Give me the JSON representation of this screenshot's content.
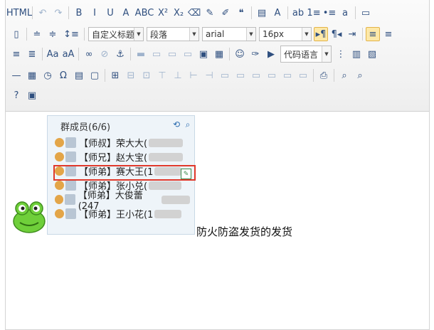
{
  "toolbar": {
    "row1": [
      {
        "name": "source-code-button",
        "text": "HTML"
      },
      {
        "name": "undo-button",
        "text": "↶"
      },
      {
        "name": "redo-button",
        "text": "↷"
      },
      {
        "name": "bold-button",
        "text": "B"
      },
      {
        "name": "italic-button",
        "text": "I"
      },
      {
        "name": "underline-button",
        "text": "U"
      },
      {
        "name": "font-border-button",
        "text": "A"
      },
      {
        "name": "strikethrough-button",
        "text": "ABC"
      },
      {
        "name": "superscript-button",
        "text": "X²"
      },
      {
        "name": "subscript-button",
        "text": "X₂"
      },
      {
        "name": "eraser-icon",
        "text": "⌫"
      },
      {
        "name": "format-painter-icon",
        "text": "✎"
      },
      {
        "name": "auto-format-icon",
        "text": "✐"
      },
      {
        "name": "blockquote-button",
        "text": "❝"
      },
      {
        "name": "paste-plain-icon",
        "text": "▤"
      },
      {
        "name": "font-color-button",
        "text": "A"
      },
      {
        "name": "back-color-button",
        "text": "ab"
      },
      {
        "name": "ordered-list-button",
        "text": "1≡"
      },
      {
        "name": "unordered-list-button",
        "text": "•≡"
      },
      {
        "name": "select-all-button",
        "text": "a"
      },
      {
        "name": "clear-doc-button",
        "text": "▭"
      }
    ],
    "selects": {
      "custom_title": "自定义标题",
      "paragraph": "段落",
      "font_family": "arial",
      "font_size": "16px",
      "code_language": "代码语言"
    },
    "row2_btns": [
      {
        "name": "clear-format-icon",
        "text": "▯"
      },
      {
        "name": "row-spacing-top-button",
        "text": "≐"
      },
      {
        "name": "row-spacing-bottom-button",
        "text": "≑"
      },
      {
        "name": "line-height-button",
        "text": "↕≡"
      }
    ],
    "row2_after": [
      {
        "name": "ltr-button",
        "text": "▸¶"
      },
      {
        "name": "rtl-button",
        "text": "¶◂"
      },
      {
        "name": "indent-button",
        "text": "⇥"
      },
      {
        "name": "align-left-button",
        "text": "≡"
      },
      {
        "name": "align-center-button",
        "text": "≡"
      }
    ],
    "row3": [
      {
        "name": "align-right-button",
        "text": "≡"
      },
      {
        "name": "justify-button",
        "text": "≣"
      },
      {
        "name": "to-uppercase-button",
        "text": "Aa"
      },
      {
        "name": "to-lowercase-button",
        "text": "aA"
      },
      {
        "name": "link-icon",
        "text": "∞"
      },
      {
        "name": "unlink-icon",
        "text": "⊘"
      },
      {
        "name": "anchor-icon",
        "text": "⚓"
      },
      {
        "name": "image-none-icon",
        "text": "▬"
      },
      {
        "name": "image-left-icon",
        "text": "▭"
      },
      {
        "name": "image-right-icon",
        "text": "▭"
      },
      {
        "name": "image-center-icon",
        "text": "▭"
      },
      {
        "name": "simple-upload-icon",
        "text": "▣"
      },
      {
        "name": "insert-image-icon",
        "text": "▦"
      },
      {
        "name": "emotion-icon",
        "text": "☺"
      },
      {
        "name": "scrawl-icon",
        "text": "✑"
      },
      {
        "name": "insert-video-icon",
        "text": "▶"
      }
    ],
    "row3_after": [
      {
        "name": "page-break-icon",
        "text": "⋮"
      },
      {
        "name": "template-icon",
        "text": "▥"
      },
      {
        "name": "background-icon",
        "text": "▧"
      }
    ],
    "row4": [
      {
        "name": "horizontal-rule-icon",
        "text": "—"
      },
      {
        "name": "date-icon",
        "text": "▦"
      },
      {
        "name": "time-icon",
        "text": "◷"
      },
      {
        "name": "special-char-icon",
        "text": "Ω"
      },
      {
        "name": "wordimage-icon",
        "text": "▤"
      },
      {
        "name": "snapscreen-icon",
        "text": "▢"
      },
      {
        "name": "insert-table-icon",
        "text": "⊞"
      },
      {
        "name": "delete-table-icon",
        "text": "⊟"
      },
      {
        "name": "insert-paragraph-before-table-icon",
        "text": "⊡"
      },
      {
        "name": "insert-row-icon",
        "text": "⊤"
      },
      {
        "name": "delete-row-icon",
        "text": "⊥"
      },
      {
        "name": "insert-col-icon",
        "text": "⊢"
      },
      {
        "name": "delete-col-icon",
        "text": "⊣"
      },
      {
        "name": "merge-cells-icon",
        "text": "▭"
      },
      {
        "name": "merge-right-icon",
        "text": "▭"
      },
      {
        "name": "merge-down-icon",
        "text": "▭"
      },
      {
        "name": "split-cells-icon",
        "text": "▭"
      },
      {
        "name": "split-rows-icon",
        "text": "▭"
      },
      {
        "name": "split-cols-icon",
        "text": "▭"
      },
      {
        "name": "print-icon",
        "text": "⎙"
      },
      {
        "name": "preview-icon",
        "text": "⌕"
      },
      {
        "name": "search-replace-icon",
        "text": "⌕"
      }
    ],
    "row5": [
      {
        "name": "help-icon",
        "text": "?"
      },
      {
        "name": "drafts-icon",
        "text": "▣"
      }
    ]
  },
  "qq": {
    "title": "群成员(6/6)",
    "members": [
      {
        "label": "【师叔】荣大大("
      },
      {
        "label": "【师兄】赵大宝("
      },
      {
        "label": "【师弟】赛大王(1"
      },
      {
        "label": "【师弟】张小兑("
      },
      {
        "label": "【师弟】大俊蕾(247"
      },
      {
        "label": "【师弟】王小花(1"
      }
    ]
  },
  "caption": "防火防盗发货的发货",
  "colors": {
    "accent_active": "#fde8a8",
    "highlight": "#e0392b",
    "frog": "#6fcf3a"
  }
}
